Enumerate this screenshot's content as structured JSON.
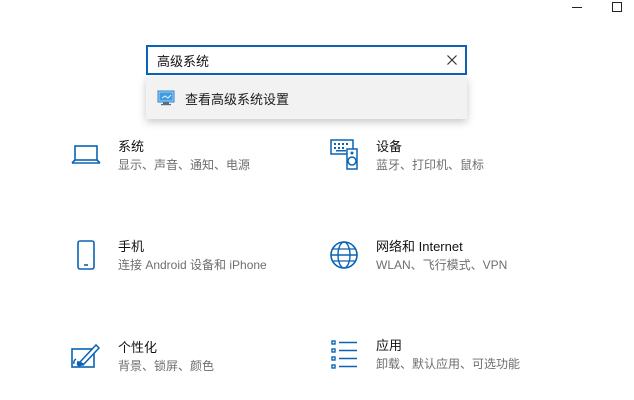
{
  "search": {
    "value": "高级系统",
    "suggestion": "查看高级系统设置"
  },
  "categories": [
    {
      "title": "系统",
      "desc": "显示、声音、通知、电源",
      "icon": "laptop-icon"
    },
    {
      "title": "设备",
      "desc": "蓝牙、打印机、鼠标",
      "icon": "keyboard-speaker-icon"
    },
    {
      "title": "手机",
      "desc": "连接 Android 设备和 iPhone",
      "icon": "phone-icon"
    },
    {
      "title": "网络和 Internet",
      "desc": "WLAN、飞行模式、VPN",
      "icon": "globe-icon"
    },
    {
      "title": "个性化",
      "desc": "背景、锁屏、颜色",
      "icon": "paint-icon"
    },
    {
      "title": "应用",
      "desc": "卸载、默认应用、可选功能",
      "icon": "apps-list-icon"
    }
  ],
  "colors": {
    "accent": "#0a63b4",
    "icon": "#0a63b4"
  }
}
